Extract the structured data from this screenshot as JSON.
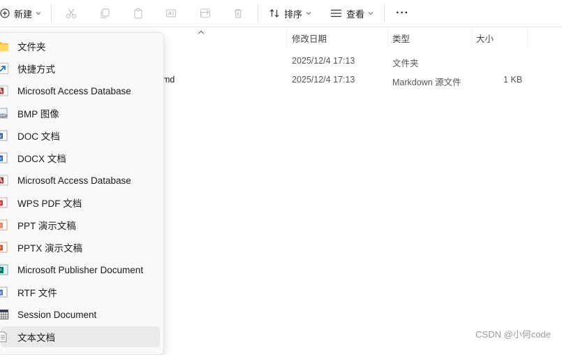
{
  "toolbar": {
    "new_label": "新建",
    "sort_label": "排序",
    "view_label": "查看",
    "more_label": "···"
  },
  "columns": {
    "modified": "修改日期",
    "type": "类型",
    "size": "大小"
  },
  "rows": [
    {
      "name": "",
      "modified": "2025/12/4 17:13",
      "type": "文件夹",
      "size": ""
    },
    {
      "name": "md",
      "modified": "2025/12/4 17:13",
      "type": "Markdown 源文件",
      "size": "1 KB"
    }
  ],
  "new_menu": {
    "items": [
      {
        "label": "文件夹",
        "icon": "folder-icon"
      },
      {
        "label": "快捷方式",
        "icon": "shortcut-icon"
      },
      {
        "label": "Microsoft Access Database",
        "icon": "access-icon"
      },
      {
        "label": "BMP 图像",
        "icon": "bmp-icon"
      },
      {
        "label": "DOC 文档",
        "icon": "doc-icon"
      },
      {
        "label": "DOCX 文档",
        "icon": "docx-icon"
      },
      {
        "label": "Microsoft Access Database",
        "icon": "access-icon"
      },
      {
        "label": "WPS PDF 文档",
        "icon": "pdf-icon"
      },
      {
        "label": "PPT 演示文稿",
        "icon": "ppt-icon"
      },
      {
        "label": "PPTX 演示文稿",
        "icon": "pptx-icon"
      },
      {
        "label": "Microsoft Publisher Document",
        "icon": "publisher-icon"
      },
      {
        "label": "RTF 文件",
        "icon": "rtf-icon"
      },
      {
        "label": "Session Document",
        "icon": "session-icon"
      },
      {
        "label": "文本文档",
        "icon": "text-icon"
      }
    ]
  },
  "watermark": "CSDN @小何code",
  "colors": {
    "access": "#a4373a",
    "word": "#2b5797",
    "pdf": "#d83b3b",
    "ppt": "#d35230",
    "publisher": "#077568",
    "folder": "#f5c142"
  }
}
